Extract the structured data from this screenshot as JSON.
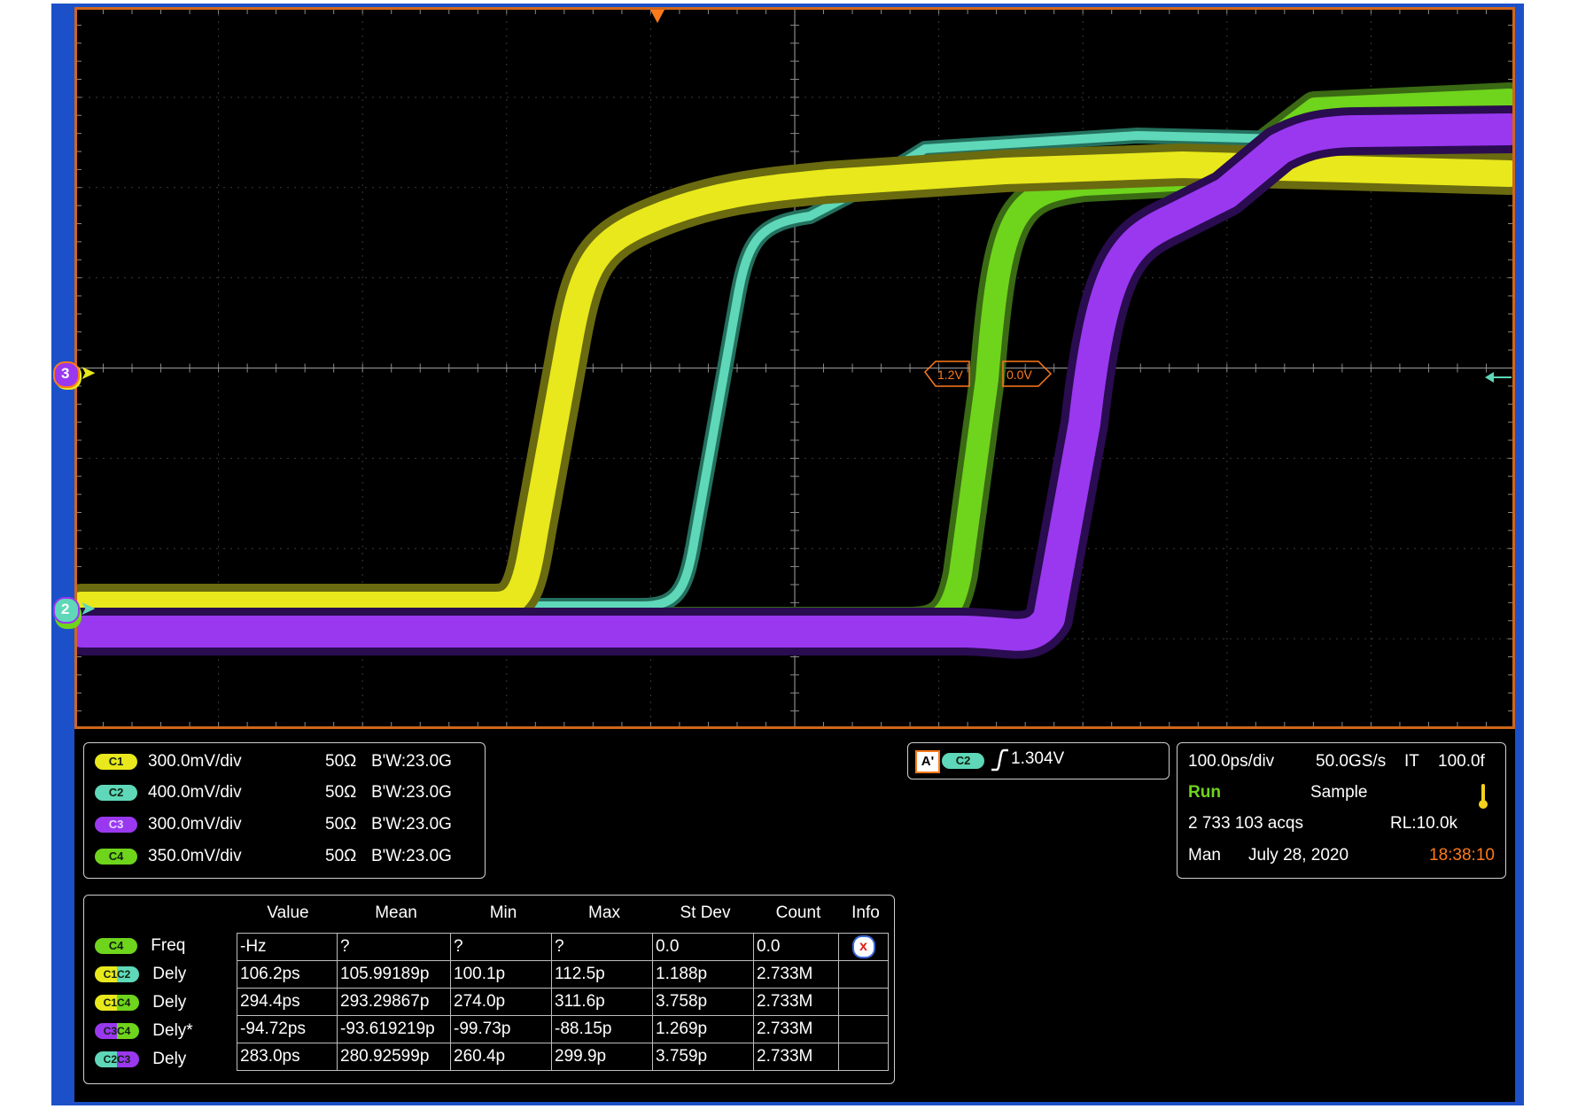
{
  "channels": [
    {
      "chip": "C1",
      "scale": "300.0mV/div",
      "impedance": "50Ω",
      "bandwidth": "B'W:23.0G",
      "color": "#e8e81c"
    },
    {
      "chip": "C2",
      "scale": "400.0mV/div",
      "impedance": "50Ω",
      "bandwidth": "B'W:23.0G",
      "color": "#5ed8b8"
    },
    {
      "chip": "C3",
      "scale": "300.0mV/div",
      "impedance": "50Ω",
      "bandwidth": "B'W:23.0G",
      "color": "#9a38f0"
    },
    {
      "chip": "C4",
      "scale": "350.0mV/div",
      "impedance": "50Ω",
      "bandwidth": "B'W:23.0G",
      "color": "#6fd41c"
    }
  ],
  "trigger": {
    "mode": "A'",
    "source": "C2",
    "slope_icon": "rising-edge-icon",
    "level": "1.304V"
  },
  "acquisition": {
    "timebase": "100.0ps/div",
    "sample_rate": "50.0GS/s",
    "it_label": "IT",
    "it_value": "100.0f",
    "state": "Run",
    "mode": "Sample",
    "acqs": "2 733 103 acqs",
    "record_length": "RL:10.0k",
    "trigger_type": "Man",
    "date": "July 28, 2020",
    "time": "18:38:10"
  },
  "markers": {
    "ch3_marker": "3",
    "ch2_marker": "2",
    "ref_level_1": "1.2V",
    "ref_level_2": "0.0V"
  },
  "measurements": {
    "headers": [
      "Value",
      "Mean",
      "Min",
      "Max",
      "St Dev",
      "Count",
      "Info"
    ],
    "rows": [
      {
        "src": "C4",
        "name": "Freq",
        "value": "-Hz",
        "mean": "?",
        "min": "?",
        "max": "?",
        "stdev": "0.0",
        "count": "0.0",
        "info": "x"
      },
      {
        "src": "C1C2",
        "name": "Dely",
        "value": "106.2ps",
        "mean": "105.99189p",
        "min": "100.1p",
        "max": "112.5p",
        "stdev": "1.188p",
        "count": "2.733M",
        "info": ""
      },
      {
        "src": "C1C4",
        "name": "Dely",
        "value": "294.4ps",
        "mean": "293.29867p",
        "min": "274.0p",
        "max": "311.6p",
        "stdev": "3.758p",
        "count": "2.733M",
        "info": ""
      },
      {
        "src": "C3C4",
        "name": "Dely*",
        "value": "-94.72ps",
        "mean": "-93.619219p",
        "min": "-99.73p",
        "max": "-88.15p",
        "stdev": "1.269p",
        "count": "2.733M",
        "info": ""
      },
      {
        "src": "C2C3",
        "name": "Dely",
        "value": "283.0ps",
        "mean": "280.92599p",
        "min": "260.4p",
        "max": "299.9p",
        "stdev": "3.759p",
        "count": "2.733M",
        "info": ""
      }
    ]
  },
  "colors": {
    "c1": "#e8e81c",
    "c2": "#5ed8b8",
    "c3": "#9a38f0",
    "c4": "#6fd41c",
    "graticule_border": "#d0661c",
    "frame": "#1c50c8",
    "timestamp": "#ff7a1a",
    "run": "#6fd41c"
  }
}
